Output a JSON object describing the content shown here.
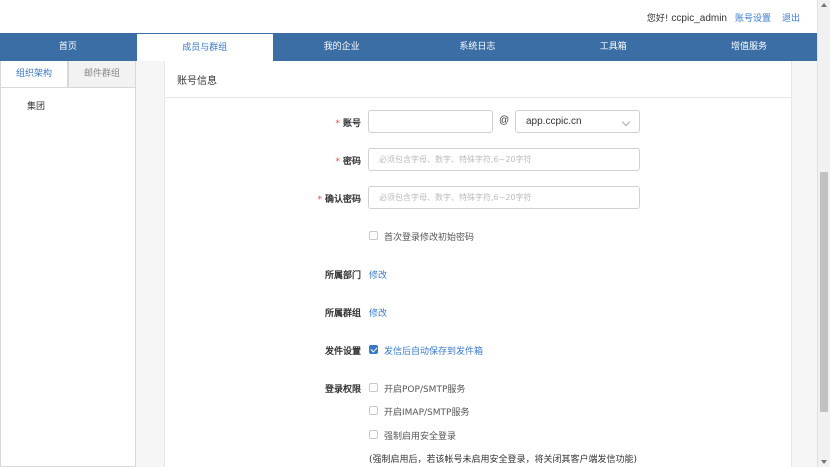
{
  "header": {
    "greeting": "您好! ",
    "username": "ccpic_admin",
    "account_settings": "账号设置",
    "logout": "退出"
  },
  "nav": {
    "items": [
      {
        "label": "首页",
        "active": false
      },
      {
        "label": "成员与群组",
        "active": true
      },
      {
        "label": "我的企业",
        "active": false
      },
      {
        "label": "系统日志",
        "active": false
      },
      {
        "label": "工具箱",
        "active": false
      },
      {
        "label": "增值服务",
        "active": false
      }
    ]
  },
  "sidebar": {
    "tabs": [
      {
        "label": "组织架构",
        "active": true
      },
      {
        "label": "邮件群组",
        "active": false
      }
    ],
    "tree": [
      "集团"
    ]
  },
  "panel": {
    "title": "账号信息",
    "account_label": "账号",
    "account_value": "",
    "at_symbol": "@",
    "domain_value": "app.ccpic.cn",
    "password_label": "密码",
    "password_placeholder": "必须包含字母、数字、特殊字符,6~20字符",
    "confirm_label": "确认密码",
    "confirm_placeholder": "必须包含字母、数字、特殊字符,6~20字符",
    "first_login_change": "首次登录修改初始密码",
    "dept_label": "所属部门",
    "dept_action": "修改",
    "group_label": "所属群组",
    "group_action": "修改",
    "send_label": "发件设置",
    "send_option": "发信后自动保存到发件箱",
    "login_label": "登录权限",
    "login_pop": "开启POP/SMTP服务",
    "login_imap": "开启IMAP/SMTP服务",
    "login_secure": "强制启用安全登录",
    "login_note": "(强制启用后，若该帐号未启用安全登录，将关闭其客户端发信功能)"
  },
  "colors": {
    "nav_bg": "#3a6ea5",
    "link": "#3a78c8",
    "required": "#e14a4a"
  }
}
